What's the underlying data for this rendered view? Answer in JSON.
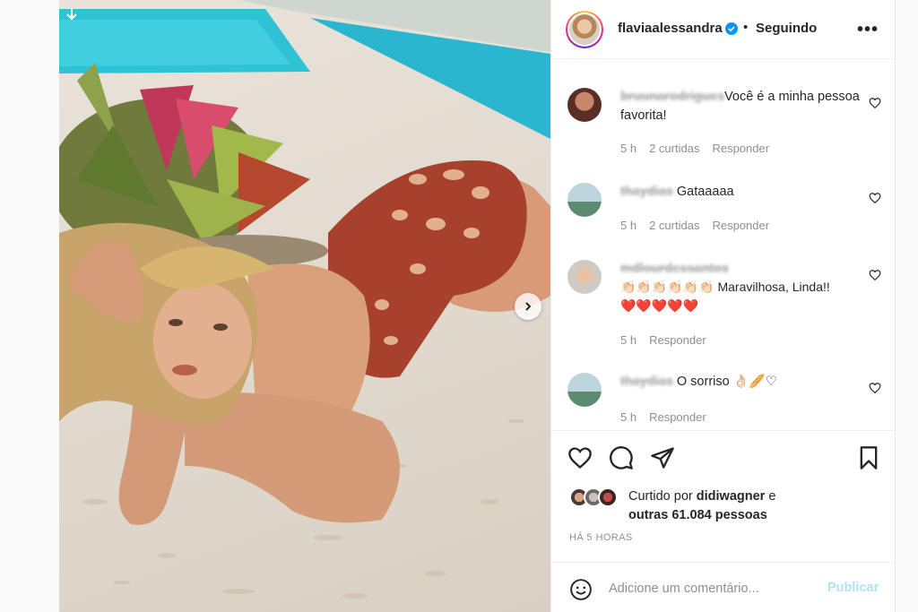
{
  "post": {
    "author": "flaviaalessandra",
    "separator": "•",
    "follow_status": "Seguindo",
    "more_label": "•••"
  },
  "comments": [
    {
      "user": "bruunarodrigues",
      "text": "Você é a minha pessoa favorita!",
      "time": "5 h",
      "likes": "2 curtidas",
      "reply": "Responder"
    },
    {
      "user": "thaydias",
      "text": "Gataaaaa",
      "time": "5 h",
      "likes": "2 curtidas",
      "reply": "Responder"
    },
    {
      "user": "mdlourdessantos",
      "text_before": "👏🏻👏🏻👏🏻👏🏻👏🏻👏🏻 Maravilhosa, Linda!!",
      "hearts": "❤️❤️❤️❤️❤️",
      "time": "5 h",
      "reply": "Responder"
    },
    {
      "user": "thaydias",
      "text": "O sorriso 👌🏻🥖♡",
      "time": "5 h",
      "reply": "Responder"
    }
  ],
  "likes": {
    "prefix": "Curtido por",
    "first_user": "didiwagner",
    "connector": "e",
    "others": "outras 61.084 pessoas"
  },
  "timestamp": "HÁ 5 HORAS",
  "composer": {
    "placeholder": "Adicione um comentário...",
    "publish_label": "Publicar"
  },
  "colors": {
    "accent": "#0095f6",
    "publish_disabled": "#b2dffc",
    "like_red": "#e0182d"
  },
  "icons": {
    "header": "verified-badge-icon",
    "actions": [
      "heart-icon",
      "comment-icon",
      "share-icon",
      "bookmark-icon"
    ],
    "composer": "smiley-icon",
    "carousel": "chevron-right-icon"
  }
}
